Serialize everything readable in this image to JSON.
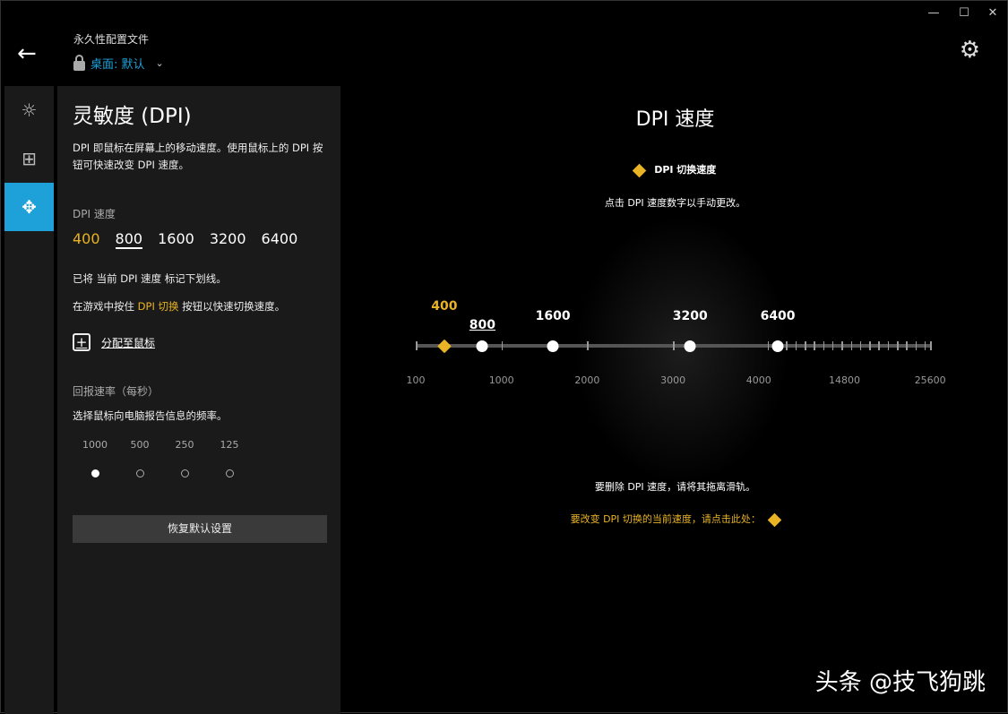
{
  "window": {
    "minimize": "—",
    "maximize": "☐",
    "close": "✕"
  },
  "header": {
    "profile_title": "永久性配置文件",
    "profile_name": "桌面: 默认"
  },
  "panel": {
    "title": "灵敏度 (DPI)",
    "description": "DPI 即鼠标在屏幕上的移动速度。使用鼠标上的 DPI 按钮可快速改变 DPI 速度。",
    "dpi_label": "DPI 速度",
    "dpi_speeds": [
      "400",
      "800",
      "1600",
      "3200",
      "6400"
    ],
    "current_note": "已将 当前 DPI 速度 标记下划线。",
    "shift_note_pre": "在游戏中按住 ",
    "shift_note_hl": "DPI 切换",
    "shift_note_post": " 按钮以快速切换速度。",
    "assign_label": "分配至鼠标",
    "report_label": "回报速率（每秒）",
    "report_desc": "选择鼠标向电脑报告信息的频率。",
    "report_rates": [
      "1000",
      "500",
      "250",
      "125"
    ],
    "report_selected": "1000",
    "reset_label": "恢复默认设置"
  },
  "main": {
    "title": "DPI 速度",
    "legend": "DPI 切换速度",
    "hint": "点击 DPI 速度数字以手动更改。",
    "remove_hint": "要删除 DPI 速度，请将其拖离滑轨。",
    "shift_hint": "要改变 DPI 切换的当前速度，请点击此处：",
    "axis_labels": [
      "100",
      "1000",
      "2000",
      "3000",
      "4000",
      "14800",
      "25600"
    ],
    "points": [
      {
        "value": 400,
        "label": "400",
        "shift": true
      },
      {
        "value": 800,
        "label": "800",
        "current": true
      },
      {
        "value": 1600,
        "label": "1600"
      },
      {
        "value": 3200,
        "label": "3200"
      },
      {
        "value": 6400,
        "label": "6400"
      }
    ],
    "accent": "#e8b324"
  },
  "watermark": "头条 @技飞狗跳"
}
